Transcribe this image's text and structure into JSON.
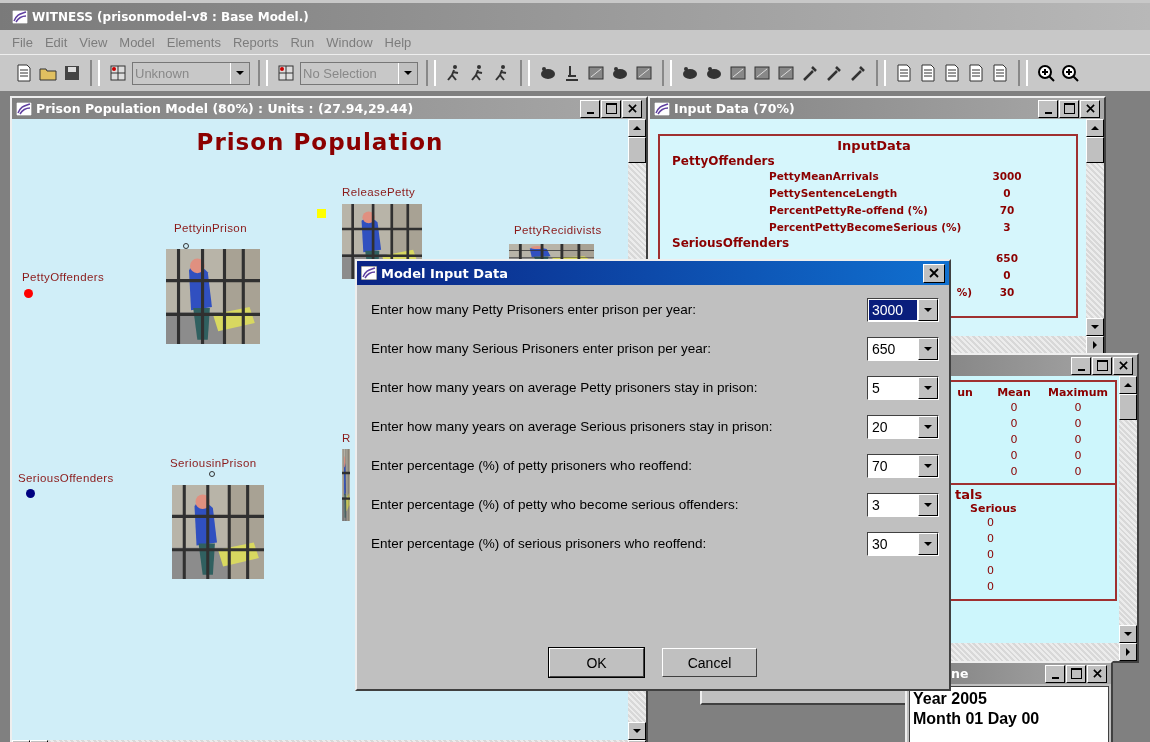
{
  "app": {
    "title": "WITNESS (prisonmodel-v8 : Base Model.)"
  },
  "menu": [
    {
      "label": "File",
      "disabled": true
    },
    {
      "label": "Edit",
      "disabled": true
    },
    {
      "label": "View",
      "disabled": true
    },
    {
      "label": "Model",
      "disabled": true
    },
    {
      "label": "Elements",
      "disabled": true
    },
    {
      "label": "Reports",
      "disabled": true
    },
    {
      "label": "Run",
      "disabled": true
    },
    {
      "label": "Window",
      "disabled": true
    },
    {
      "label": "Help",
      "disabled": true
    }
  ],
  "toolbar": {
    "dropdowns": [
      {
        "value": "Unknown",
        "disabled": true
      },
      {
        "value": "No Selection",
        "disabled": true
      }
    ]
  },
  "model_window": {
    "title": "Prison Population Model (80%)  : Units : (27.94,29.44)",
    "heading": "Prison Population",
    "nodes": [
      {
        "kind": "source",
        "label": "PettyOffenders",
        "color": "#ff0000"
      },
      {
        "kind": "activity",
        "label": "PettyinPrison"
      },
      {
        "kind": "activity",
        "label": "ReleasePetty"
      },
      {
        "kind": "activity",
        "label": "PettyRecidivists"
      },
      {
        "kind": "source",
        "label": "SeriousOffenders",
        "color": "#000080"
      },
      {
        "kind": "activity",
        "label": "SeriousinPrison"
      },
      {
        "kind": "activity",
        "label": "R"
      }
    ],
    "markers": [
      {
        "color": "#ffff00"
      }
    ]
  },
  "input_window": {
    "title": "Input Data (70%)",
    "heading": "InputData",
    "petty": {
      "heading": "PettyOffenders",
      "rows": [
        {
          "label": "PettyMeanArrivals",
          "value": "3000"
        },
        {
          "label": "PettySentenceLength",
          "value": "0"
        },
        {
          "label": "PercentPettyRe-offend (%)",
          "value": "70"
        },
        {
          "label": "PercentPettyBecomeSerious (%)",
          "value": "3"
        }
      ]
    },
    "serious": {
      "heading": "SeriousOffenders",
      "rows": [
        {
          "value": "650"
        },
        {
          "value": "0"
        },
        {
          "label": "%)",
          "value": "30"
        }
      ]
    }
  },
  "stats_window": {
    "columns": [
      "un",
      "Mean",
      "Maximum"
    ],
    "rows": [
      [
        "",
        "0",
        "0"
      ],
      [
        "",
        "0",
        "0"
      ],
      [
        "",
        "0",
        "0"
      ],
      [
        "",
        "0",
        "0"
      ],
      [
        "",
        "0",
        "0"
      ]
    ],
    "section": "tals",
    "section_column": "Serious",
    "section_values": [
      "0",
      "0",
      "0",
      "0",
      "0"
    ]
  },
  "time_window": {
    "title": "ne",
    "lines": [
      "Year 2005",
      "Month 01 Day 00"
    ]
  },
  "dialog": {
    "title": "Model Input Data",
    "fields": [
      {
        "label": "Enter how many Petty Prisoners enter prison per year:",
        "value": "3000",
        "selected": true
      },
      {
        "label": "Enter how many Serious Prisoners enter prison per year:",
        "value": "650",
        "selected": false
      },
      {
        "label": "Enter how many years on average Petty prisoners stay in prison:",
        "value": "5",
        "selected": false
      },
      {
        "label": "Enter how many years on average Serious prisoners stay in prison:",
        "value": "20",
        "selected": false
      },
      {
        "label": "Enter percentage (%) of petty prisoners who reoffend:",
        "value": "70",
        "selected": false
      },
      {
        "label": "Enter percentage (%) of petty who become serious offenders:",
        "value": "3",
        "selected": false
      },
      {
        "label": "Enter percentage (%) of serious prisoners who reoffend:",
        "value": "30",
        "selected": false
      }
    ],
    "buttons": [
      {
        "label": "OK",
        "default": true
      },
      {
        "label": "Cancel",
        "default": false
      }
    ]
  }
}
